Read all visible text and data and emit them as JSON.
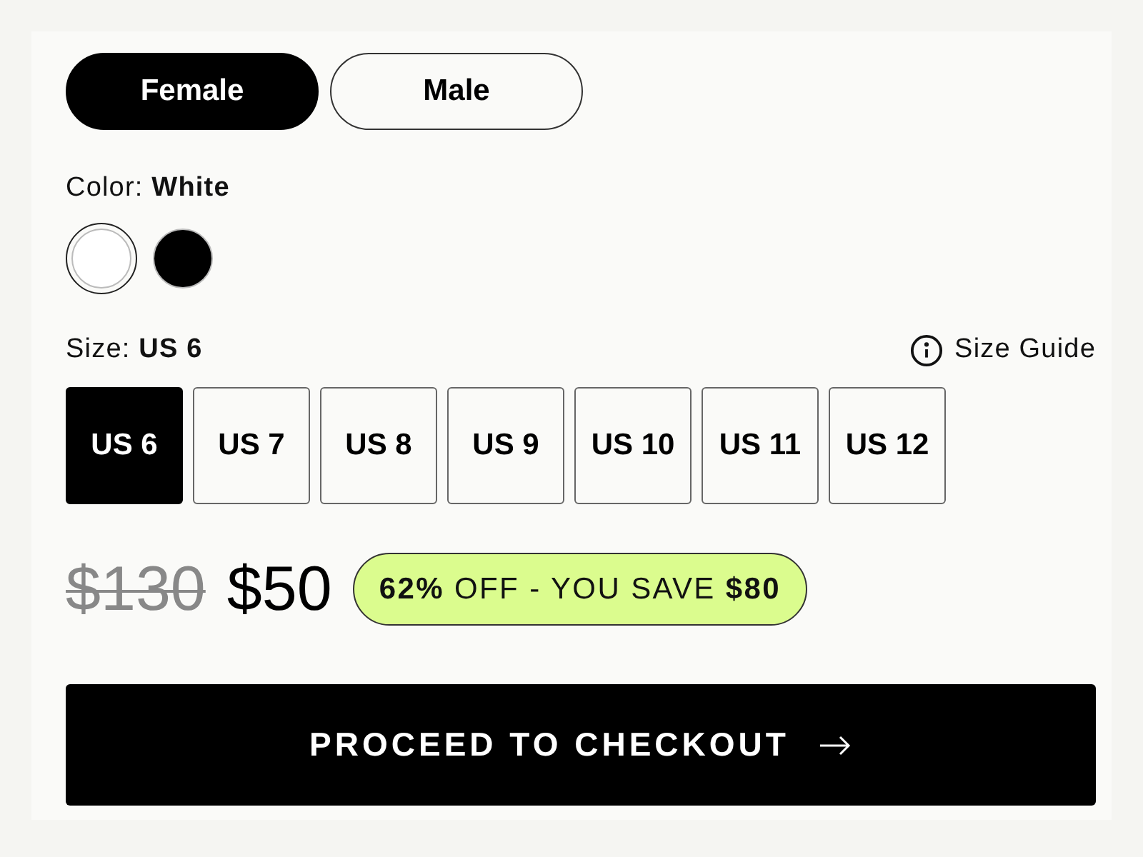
{
  "gender_toggle": [
    {
      "label": "Female",
      "selected": true
    },
    {
      "label": "Male",
      "selected": false
    }
  ],
  "color": {
    "label": "Color: **White**",
    "swatches": [
      {
        "color": "#ffffff",
        "selected": true
      },
      {
        "color": "#000000",
        "selected": false
      }
    ]
  },
  "size": {
    "label": "Size: **US 6**",
    "guide": "Size Guide",
    "options": [
      {
        "label": "US 6",
        "selected": true
      },
      {
        "label": "US 7",
        "selected": false
      },
      {
        "label": "US 8",
        "selected": false
      },
      {
        "label": "US 9",
        "selected": false
      },
      {
        "label": "US 10",
        "selected": false
      },
      {
        "label": "US 11",
        "selected": false
      },
      {
        "label": "US 12",
        "selected": false
      }
    ]
  },
  "price": {
    "original": "$130",
    "current": "$50",
    "badge": "**62%** OFF - YOU SAVE **$80**"
  },
  "checkout": {
    "label": "PROCEED TO CHECKOUT"
  }
}
